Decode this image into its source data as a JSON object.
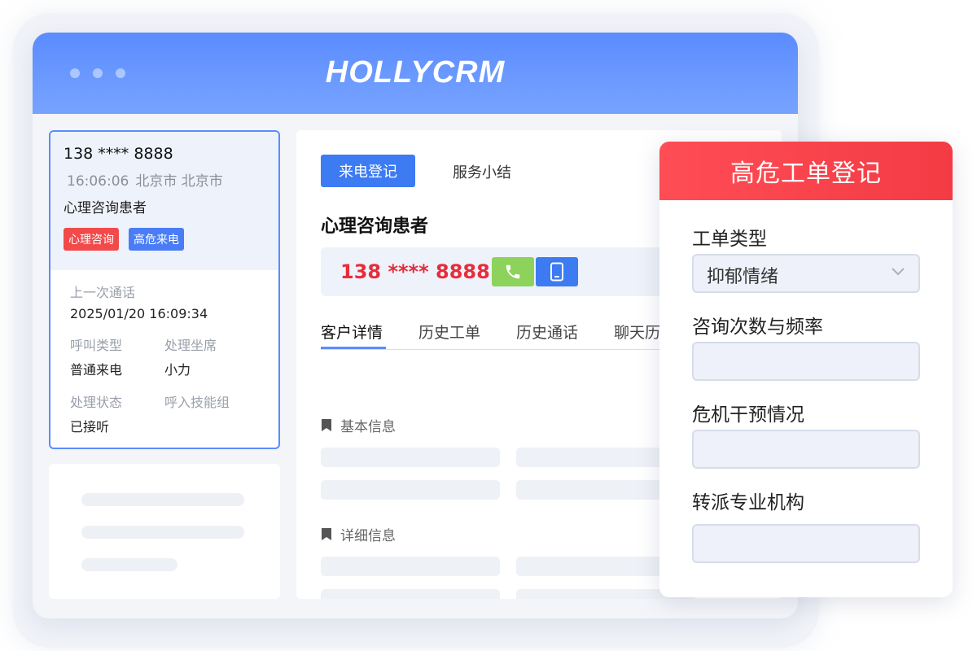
{
  "app": {
    "title": "HOLLYCRM"
  },
  "caller": {
    "phone": "138 **** 8888",
    "time": "16:06:06",
    "location": "北京市 北京市",
    "name": "心理咨询患者",
    "tags": [
      "心理咨询",
      "高危来电"
    ],
    "last_call_label": "上一次通话",
    "last_call_value": "2025/01/20  16:09:34",
    "call_type_label": "呼叫类型",
    "call_type_value": "普通来电",
    "agent_label": "处理坐席",
    "agent_value": "小力",
    "status_label": "处理状态",
    "status_value": "已接听",
    "skill_group_label": "呼入技能组"
  },
  "center": {
    "register_button": "来电登记",
    "summary_link": "服务小结",
    "customer_name": "心理咨询患者",
    "phone": "138 **** 8888",
    "tabs": [
      "客户详情",
      "历史工单",
      "历史通话",
      "聊天历"
    ],
    "basic_info_title": "基本信息",
    "detail_info_title": "详细信息"
  },
  "form": {
    "title": "高危工单登记",
    "ticket_type_label": "工单类型",
    "ticket_type_value": "抑郁情绪",
    "frequency_label": "咨询次数与频率",
    "frequency_value": "",
    "crisis_label": "危机干预情况",
    "crisis_value": "",
    "referral_label": "转派专业机构",
    "referral_value": ""
  },
  "colors": {
    "brand_blue": "#5b8cff",
    "alert_red": "#f33b44",
    "phone_red": "#e82d3a",
    "call_green": "#8dd25a"
  },
  "icons": [
    "phone-icon",
    "mobile-icon",
    "bookmark-icon",
    "chevron-down-icon"
  ]
}
